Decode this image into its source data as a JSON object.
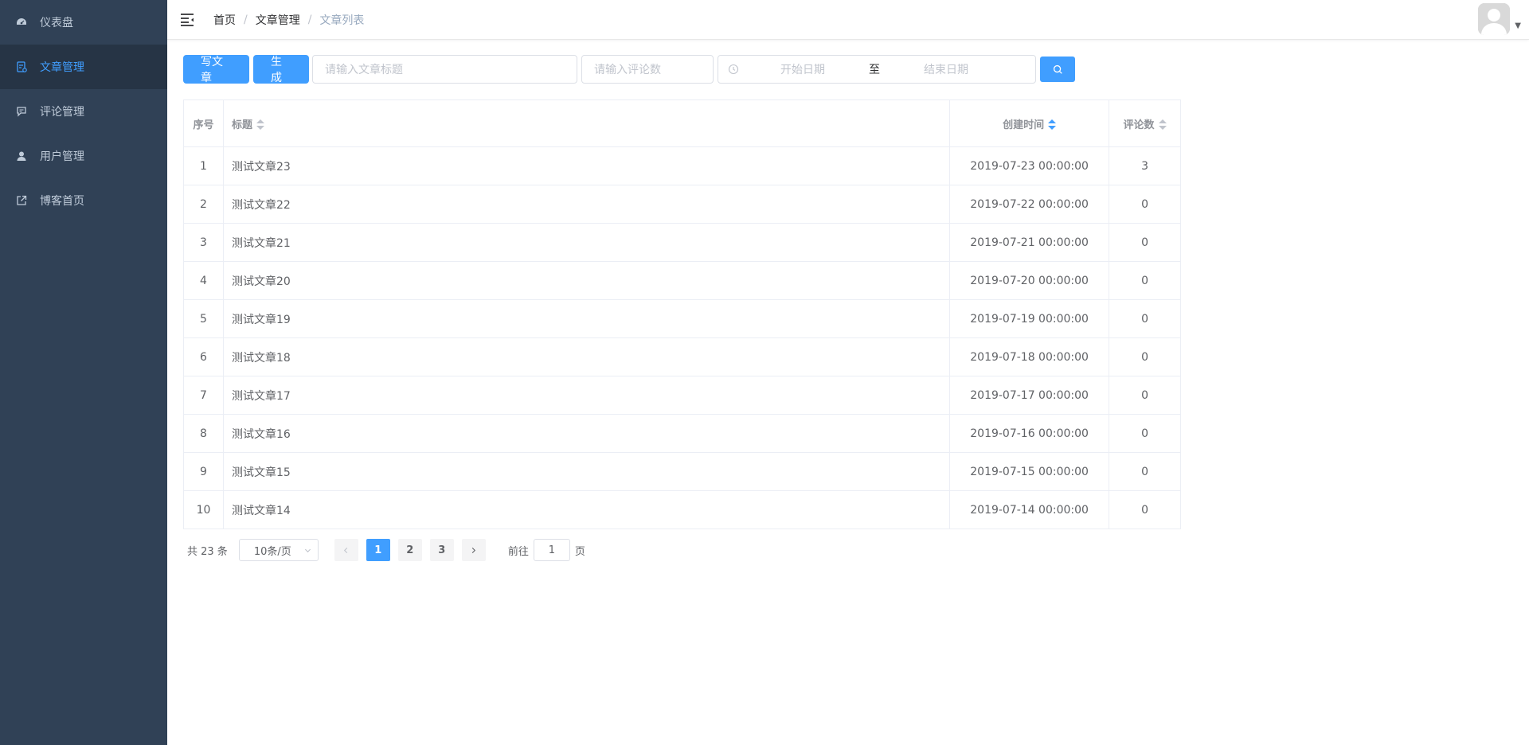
{
  "sidebar": {
    "items": [
      {
        "label": "仪表盘",
        "icon": "dashboard-icon",
        "active": false
      },
      {
        "label": "文章管理",
        "icon": "document-icon",
        "active": true
      },
      {
        "label": "评论管理",
        "icon": "comment-icon",
        "active": false
      },
      {
        "label": "用户管理",
        "icon": "user-icon",
        "active": false
      },
      {
        "label": "博客首页",
        "icon": "external-link-icon",
        "active": false
      }
    ]
  },
  "header": {
    "breadcrumb": [
      "首页",
      "文章管理",
      "文章列表"
    ],
    "separator": "/"
  },
  "toolbar": {
    "write_label": "写文章",
    "generate_label": "生成",
    "title_placeholder": "请输入文章标题",
    "comments_placeholder": "请输入评论数",
    "start_date_placeholder": "开始日期",
    "range_separator": "至",
    "end_date_placeholder": "结束日期"
  },
  "table": {
    "headers": {
      "index": "序号",
      "title": "标题",
      "created": "创建时间",
      "comments": "评论数"
    },
    "rows": [
      {
        "index": "1",
        "title": "测试文章23",
        "created": "2019-07-23 00:00:00",
        "comments": "3"
      },
      {
        "index": "2",
        "title": "测试文章22",
        "created": "2019-07-22 00:00:00",
        "comments": "0"
      },
      {
        "index": "3",
        "title": "测试文章21",
        "created": "2019-07-21 00:00:00",
        "comments": "0"
      },
      {
        "index": "4",
        "title": "测试文章20",
        "created": "2019-07-20 00:00:00",
        "comments": "0"
      },
      {
        "index": "5",
        "title": "测试文章19",
        "created": "2019-07-19 00:00:00",
        "comments": "0"
      },
      {
        "index": "6",
        "title": "测试文章18",
        "created": "2019-07-18 00:00:00",
        "comments": "0"
      },
      {
        "index": "7",
        "title": "测试文章17",
        "created": "2019-07-17 00:00:00",
        "comments": "0"
      },
      {
        "index": "8",
        "title": "测试文章16",
        "created": "2019-07-16 00:00:00",
        "comments": "0"
      },
      {
        "index": "9",
        "title": "测试文章15",
        "created": "2019-07-15 00:00:00",
        "comments": "0"
      },
      {
        "index": "10",
        "title": "测试文章14",
        "created": "2019-07-14 00:00:00",
        "comments": "0"
      }
    ]
  },
  "pagination": {
    "total_text": "共 23 条",
    "page_size": "10条/页",
    "pages": [
      "1",
      "2",
      "3"
    ],
    "current_page": "1",
    "goto_prefix": "前往",
    "goto_value": "1",
    "goto_suffix": "页"
  },
  "colors": {
    "primary": "#409eff",
    "sidebar_bg": "#304156",
    "sidebar_active_bg": "#263445",
    "sidebar_text": "#bfcbd9"
  }
}
